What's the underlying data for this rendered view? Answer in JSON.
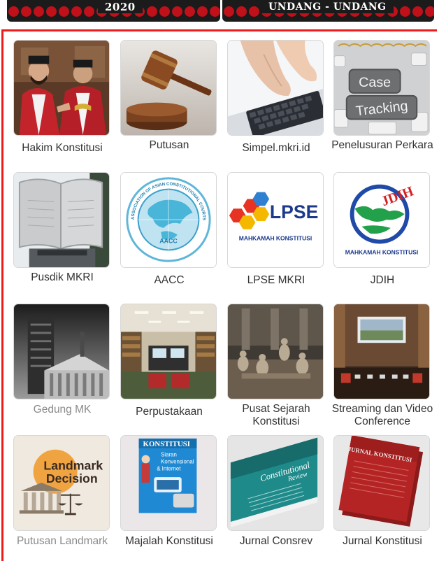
{
  "banner": {
    "left_text": "2020",
    "right_text": "UNDANG - UNDANG"
  },
  "tiles": [
    {
      "label": "Hakim Konstitusi",
      "icon": "judges-photo"
    },
    {
      "label": "Putusan",
      "icon": "gavel-photo"
    },
    {
      "label": "Simpel.mkri.id",
      "icon": "keyboard-typing-photo"
    },
    {
      "label": "Penelusuran Perkara",
      "icon": "case-tracking-keyboard",
      "keycap_1": "Case",
      "keycap_2": "Tracking"
    },
    {
      "label": "Pusdik MKRI",
      "icon": "book-monument-photo"
    },
    {
      "label": "AACC",
      "icon": "aacc-logo",
      "logo_text": "AACC",
      "ring_text": "ASSOCIATION OF ASIAN CONSTITUTIONAL COURTS AND EQUIVALENT INSTITUTIONS"
    },
    {
      "label": "LPSE MKRI",
      "icon": "lpse-logo",
      "logo_text": "LPSE",
      "logo_sub": "MAHKAMAH KONSTITUSI"
    },
    {
      "label": "JDIH",
      "icon": "jdih-logo",
      "logo_text": "JDIH",
      "logo_sub": "MAHKAMAH KONSTITUSI"
    },
    {
      "label": "Gedung MK",
      "icon": "building-photo"
    },
    {
      "label": "Perpustakaan",
      "icon": "library-photo"
    },
    {
      "label": "Pusat Sejarah Konstitusi",
      "icon": "history-diorama-photo"
    },
    {
      "label": "Streaming dan Video Conference",
      "icon": "conference-room-photo"
    },
    {
      "label": "Putusan Landmark",
      "icon": "landmark-decision-logo",
      "logo_line1": "Landmark",
      "logo_line2": "Decision"
    },
    {
      "label": "Majalah Konstitusi",
      "icon": "magazine-cover",
      "cover_title": "KONSTITUSI",
      "cover_l1": "Siaran",
      "cover_l2": "Konvensional",
      "cover_l3": "& Internet"
    },
    {
      "label": "Jurnal Consrev",
      "icon": "journal-consrev-cover",
      "cover_title": "Constitutional",
      "cover_sub": "Review"
    },
    {
      "label": "Jurnal Konstitusi",
      "icon": "journal-konstitusi-cover",
      "cover_title": "JURNAL KONSTITUSI"
    }
  ]
}
